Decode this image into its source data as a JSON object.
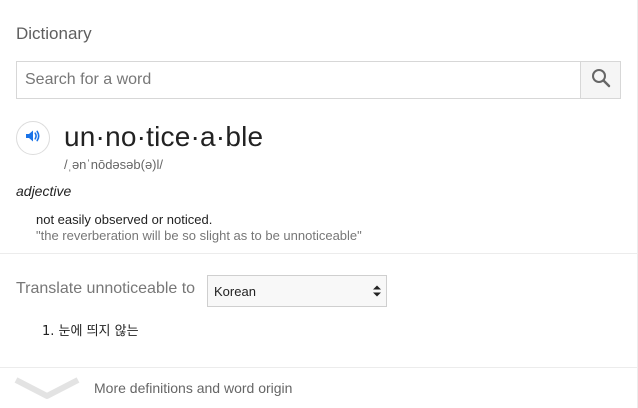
{
  "panel": {
    "title": "Dictionary"
  },
  "search": {
    "placeholder": "Search for a word",
    "value": ""
  },
  "entry": {
    "word": "un·no·tice·a·ble",
    "phonetic": "/ˌənˈnōdəsəb(ə)l/",
    "part_of_speech": "adjective",
    "definition": "not easily observed or noticed.",
    "example": "\"the reverberation will be so slight as to be unnoticeable\""
  },
  "translate": {
    "label": "Translate unnoticeable to",
    "selected_language": "Korean",
    "results": [
      "1. 눈에 띄지 않는"
    ]
  },
  "footer": {
    "more_label": "More definitions and word origin"
  },
  "colors": {
    "speaker_icon": "#1a73e8",
    "divider": "#ececec"
  },
  "icons": [
    "search-icon",
    "speaker-icon",
    "select-arrows-icon",
    "chevron-down-icon"
  ]
}
